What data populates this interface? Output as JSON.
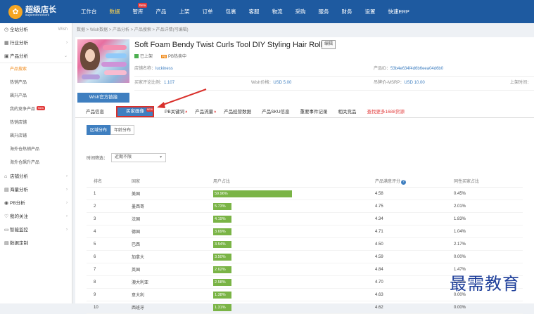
{
  "app": {
    "logo_cn": "超级店长",
    "logo_en": "superstoreclerk"
  },
  "nav": [
    {
      "label": "工作台",
      "active": false
    },
    {
      "label": "数据",
      "active": true
    },
    {
      "label": "智库",
      "active": false,
      "badge": "Beta"
    },
    {
      "label": "产品",
      "active": false
    },
    {
      "label": "上架",
      "active": false
    },
    {
      "label": "订单",
      "active": false
    },
    {
      "label": "包裹",
      "active": false
    },
    {
      "label": "客服",
      "active": false
    },
    {
      "label": "物流",
      "active": false
    },
    {
      "label": "采购",
      "active": false
    },
    {
      "label": "服务",
      "active": false
    },
    {
      "label": "财务",
      "active": false
    },
    {
      "label": "设置",
      "active": false
    },
    {
      "label": "快速ERP",
      "active": false
    }
  ],
  "sidebar": {
    "items": [
      {
        "label": "全站分析",
        "icon": "clock-icon",
        "right": "Wish"
      },
      {
        "label": "行业分析",
        "icon": "grid-icon",
        "right": "›"
      },
      {
        "label": "产品分析",
        "icon": "box-icon",
        "right": "⌄",
        "open": true
      }
    ],
    "subitems": [
      {
        "label": "产品搜索",
        "active": true
      },
      {
        "label": "热销产品"
      },
      {
        "label": "飙升产品"
      },
      {
        "label": "我的竞争产品",
        "tag": "New"
      },
      {
        "label": "热销店铺"
      },
      {
        "label": "飙升店铺"
      },
      {
        "label": "海外仓热销产品"
      },
      {
        "label": "海外仓飙升产品"
      }
    ],
    "bottom_items": [
      {
        "label": "店铺分析",
        "icon": "shop-icon",
        "right": "›"
      },
      {
        "label": "海量分析",
        "icon": "chart-icon",
        "right": "›"
      },
      {
        "label": "PB分析",
        "icon": "pb-icon",
        "right": "›"
      },
      {
        "label": "我的关注",
        "icon": "heart-icon",
        "right": "›"
      },
      {
        "label": "智能监控",
        "icon": "monitor-icon",
        "right": "›"
      },
      {
        "label": "数据定制",
        "icon": "doc-icon",
        "right": ""
      }
    ]
  },
  "breadcrumb": "数据 > Wish数据 > 产品分析 > 产品搜索 > 产品详情(可编辑)",
  "product": {
    "title": "Soft Foam Bendy Twist Curls Tool DIY Styling Hair Rollers",
    "edit_label": "编辑",
    "tags": [
      "已上架",
      "PB热卖中"
    ],
    "store_label": "店铺名称：",
    "store_value": "luckiness",
    "product_id_label": "产品ID：",
    "product_id_value": "53b4e634f4d6b6eea04d6b0",
    "rating_label": "买家评论比例：",
    "rating_value": "1.107",
    "wish_price_label": "Wish价格：",
    "wish_price_value": "USD 5.00",
    "msrp_label": "吊牌价-MSRP：",
    "msrp_value": "USD 10.00",
    "extra_label": "上架时间：",
    "wish_btn": "Wish官方链接"
  },
  "tabs": [
    {
      "label": "产品信息"
    },
    {
      "label": "买家画像",
      "active": true,
      "badge": "NEW"
    },
    {
      "label": "PB关键词",
      "fire": true
    },
    {
      "label": "产品流量",
      "fire": true
    },
    {
      "label": "产品经营数据"
    },
    {
      "label": "产品SKU信息"
    },
    {
      "label": "重要事件记录"
    },
    {
      "label": "相关竞品"
    },
    {
      "label": "查找更多1688货源",
      "link": true
    }
  ],
  "subtabs": [
    {
      "label": "区域分布",
      "active": true
    },
    {
      "label": "年龄分布"
    }
  ],
  "filter": {
    "label": "时间筛选：",
    "value": "近期不限"
  },
  "table": {
    "headers": [
      "排名",
      "国家",
      "用户占比",
      "产品满意评分",
      "同性买家占比"
    ],
    "rows": [
      {
        "rank": "1",
        "country": "美国",
        "share": "59.96%",
        "share_val": 59.96,
        "score": "4.58",
        "same": "0.45%"
      },
      {
        "rank": "2",
        "country": "墨西哥",
        "share": "5.73%",
        "share_val": 5.73,
        "score": "4.75",
        "same": "2.01%"
      },
      {
        "rank": "3",
        "country": "法国",
        "share": "4.19%",
        "share_val": 4.19,
        "score": "4.34",
        "same": "1.83%"
      },
      {
        "rank": "4",
        "country": "德国",
        "share": "3.69%",
        "share_val": 3.69,
        "score": "4.71",
        "same": "1.04%"
      },
      {
        "rank": "5",
        "country": "巴西",
        "share": "3.54%",
        "share_val": 3.54,
        "score": "4.50",
        "same": "2.17%"
      },
      {
        "rank": "6",
        "country": "加拿大",
        "share": "3.50%",
        "share_val": 3.5,
        "score": "4.59",
        "same": "0.00%"
      },
      {
        "rank": "7",
        "country": "英国",
        "share": "2.62%",
        "share_val": 2.62,
        "score": "4.84",
        "same": "1.47%"
      },
      {
        "rank": "8",
        "country": "澳大利亚",
        "share": "2.58%",
        "share_val": 2.58,
        "score": "4.70",
        "same": "1.49%"
      },
      {
        "rank": "9",
        "country": "意大利",
        "share": "1.38%",
        "share_val": 1.38,
        "score": "4.63",
        "same": "0.00%"
      },
      {
        "rank": "10",
        "country": "西班牙",
        "share": "1.31%",
        "share_val": 1.31,
        "score": "4.62",
        "same": "0.00%"
      }
    ]
  },
  "watermark": "最需教育",
  "colors": {
    "topbar": "#1e5aa0",
    "accent": "#3f7fc0",
    "bar": "#7ab446",
    "active_nav": "#ffd34d",
    "highlight": "#d9302b"
  }
}
